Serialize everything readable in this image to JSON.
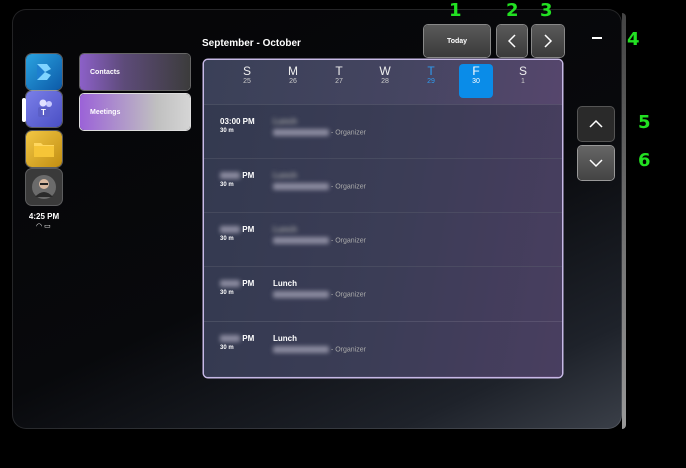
{
  "header": {
    "month_range": "September - October",
    "today_label": "Today"
  },
  "apps": [
    {
      "name": "bookings",
      "icon": "bookings-app-icon"
    },
    {
      "name": "teams",
      "icon": "teams-app-icon"
    },
    {
      "name": "files",
      "icon": "folder-icon"
    },
    {
      "name": "profile",
      "icon": "avatar-icon"
    }
  ],
  "status": {
    "time": "4:25 PM",
    "icons": [
      "wifi-icon",
      "battery-icon"
    ]
  },
  "nav": {
    "contacts": "Contacts",
    "meetings": "Meetings"
  },
  "days": [
    {
      "letter": "S",
      "num": "25"
    },
    {
      "letter": "M",
      "num": "26"
    },
    {
      "letter": "T",
      "num": "27"
    },
    {
      "letter": "W",
      "num": "28"
    },
    {
      "letter": "T",
      "num": "29"
    },
    {
      "letter": "F",
      "num": "30"
    },
    {
      "letter": "S",
      "num": "1"
    }
  ],
  "events": [
    {
      "time": "03:00 PM",
      "duration": "30 m",
      "title": "Lunch",
      "organizer": "- Organizer"
    },
    {
      "time": "PM",
      "duration": "30 m",
      "title": "Lunch",
      "organizer": "- Organizer"
    },
    {
      "time": "PM",
      "duration": "30 m",
      "title": "Lunch",
      "organizer": "- Organizer"
    },
    {
      "time": "PM",
      "duration": "30 m",
      "title": "Lunch",
      "organizer": "- Organizer"
    },
    {
      "time": "PM",
      "duration": "30 m",
      "title": "Lunch",
      "organizer": "- Organizer"
    }
  ],
  "markers": [
    "1",
    "2",
    "3",
    "4",
    "5",
    "6"
  ],
  "colors": {
    "accent": "#0a8ce8",
    "today": "#2e9bf0",
    "marker": "#22e022"
  }
}
